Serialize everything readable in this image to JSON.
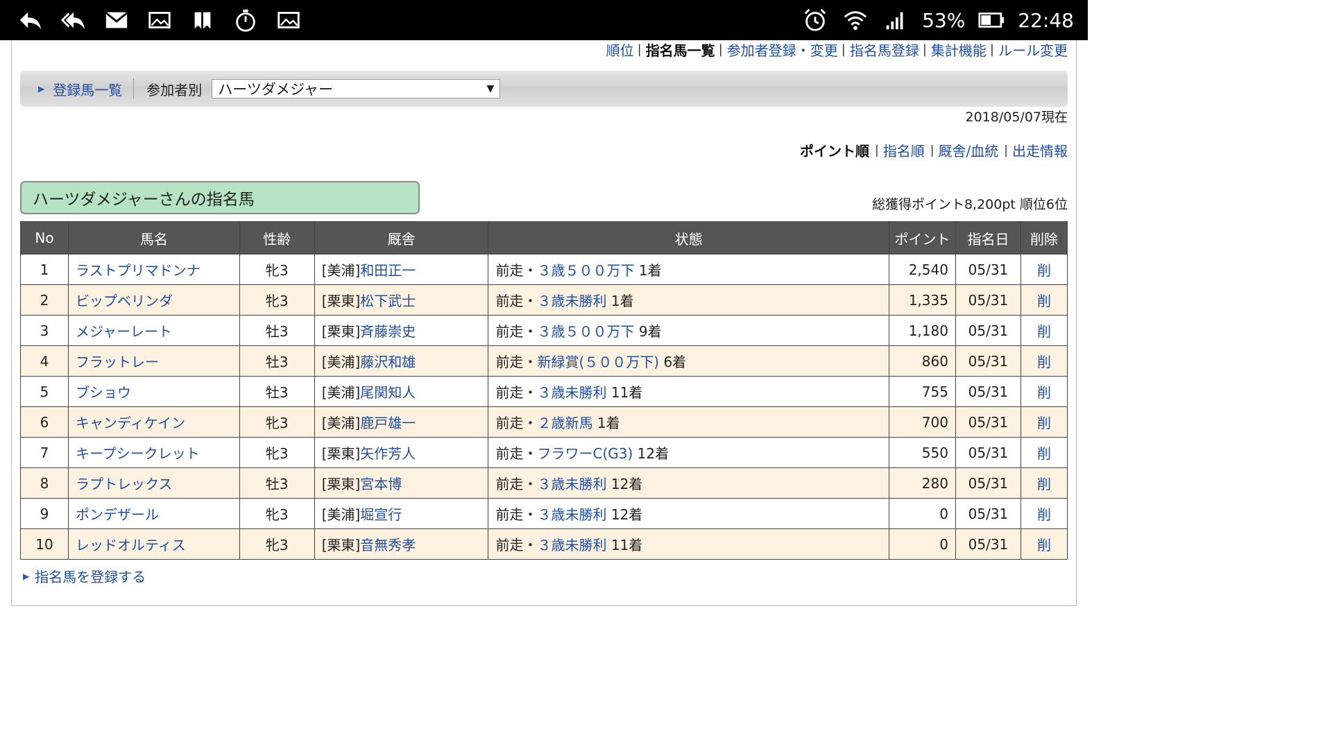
{
  "status_bar": {
    "battery": "53%",
    "time": "22:48",
    "left_icons": [
      "reply-icon",
      "reply-all-icon",
      "mail-icon",
      "image-icon",
      "bookmark-icon",
      "stopwatch-icon",
      "image-icon"
    ],
    "right_icons": [
      "alarm-icon",
      "wifi-icon",
      "signal-icon",
      "battery-icon"
    ]
  },
  "top_nav": [
    {
      "label": "順位",
      "current": false
    },
    {
      "label": "指名馬一覧",
      "current": true
    },
    {
      "label": "参加者登録・変更",
      "current": false
    },
    {
      "label": "指名馬登録",
      "current": false
    },
    {
      "label": "集計機能",
      "current": false
    },
    {
      "label": "ルール変更",
      "current": false
    }
  ],
  "filter": {
    "registered_link": "登録馬一覧",
    "participant_label": "参加者別",
    "participant_selected": "ハーツダメジャー"
  },
  "date_text": "2018/05/07現在",
  "sort": {
    "current": "ポイント順",
    "links": [
      "指名順",
      "厩舎/血統",
      "出走情報"
    ]
  },
  "section_title": "ハーツダメジャーさんの指名馬",
  "total_text": "総獲得ポイント8,200pt 順位6位",
  "table": {
    "headers": [
      "No",
      "馬名",
      "性齢",
      "厩舎",
      "状態",
      "ポイント",
      "指名日",
      "削除"
    ],
    "rows": [
      {
        "no": "1",
        "name": "ラストプリマドンナ",
        "sexage": "牝3",
        "stable_prefix": "[美浦]",
        "trainer": "和田正一",
        "status_prefix": "前走・",
        "race": "３歳５００万下",
        "finish": "1着",
        "points": "2,540",
        "date": "05/31",
        "delete": "削"
      },
      {
        "no": "2",
        "name": "ビップベリンダ",
        "sexage": "牝3",
        "stable_prefix": "[栗東]",
        "trainer": "松下武士",
        "status_prefix": "前走・",
        "race": "３歳未勝利",
        "finish": "1着",
        "points": "1,335",
        "date": "05/31",
        "delete": "削"
      },
      {
        "no": "3",
        "name": "メジャーレート",
        "sexage": "牡3",
        "stable_prefix": "[栗東]",
        "trainer": "斉藤崇史",
        "status_prefix": "前走・",
        "race": "３歳５００万下",
        "finish": "9着",
        "points": "1,180",
        "date": "05/31",
        "delete": "削"
      },
      {
        "no": "4",
        "name": "フラットレー",
        "sexage": "牡3",
        "stable_prefix": "[美浦]",
        "trainer": "藤沢和雄",
        "status_prefix": "前走・",
        "race": "新緑賞(５００万下)",
        "finish": "6着",
        "points": "860",
        "date": "05/31",
        "delete": "削"
      },
      {
        "no": "5",
        "name": "ブショウ",
        "sexage": "牡3",
        "stable_prefix": "[美浦]",
        "trainer": "尾関知人",
        "status_prefix": "前走・",
        "race": "３歳未勝利",
        "finish": "11着",
        "points": "755",
        "date": "05/31",
        "delete": "削"
      },
      {
        "no": "6",
        "name": "キャンディケイン",
        "sexage": "牝3",
        "stable_prefix": "[美浦]",
        "trainer": "鹿戸雄一",
        "status_prefix": "前走・",
        "race": "２歳新馬",
        "finish": "1着",
        "points": "700",
        "date": "05/31",
        "delete": "削"
      },
      {
        "no": "7",
        "name": "キープシークレット",
        "sexage": "牝3",
        "stable_prefix": "[栗東]",
        "trainer": "矢作芳人",
        "status_prefix": "前走・",
        "race": "フラワーC(G3)",
        "finish": "12着",
        "points": "550",
        "date": "05/31",
        "delete": "削"
      },
      {
        "no": "8",
        "name": "ラプトレックス",
        "sexage": "牡3",
        "stable_prefix": "[栗東]",
        "trainer": "宮本博",
        "status_prefix": "前走・",
        "race": "３歳未勝利",
        "finish": "12着",
        "points": "280",
        "date": "05/31",
        "delete": "削"
      },
      {
        "no": "9",
        "name": "ポンデザール",
        "sexage": "牝3",
        "stable_prefix": "[美浦]",
        "trainer": "堀宣行",
        "status_prefix": "前走・",
        "race": "３歳未勝利",
        "finish": "12着",
        "points": "0",
        "date": "05/31",
        "delete": "削"
      },
      {
        "no": "10",
        "name": "レッドオルティス",
        "sexage": "牝3",
        "stable_prefix": "[栗東]",
        "trainer": "音無秀孝",
        "status_prefix": "前走・",
        "race": "３歳未勝利",
        "finish": "11着",
        "points": "0",
        "date": "05/31",
        "delete": "削"
      }
    ]
  },
  "add_link": "指名馬を登録する",
  "colors": {
    "link": "#1f4fa8",
    "header_bg": "#555555",
    "row_alt": "#fdf2e0",
    "title_box": "#b6e3c3"
  }
}
